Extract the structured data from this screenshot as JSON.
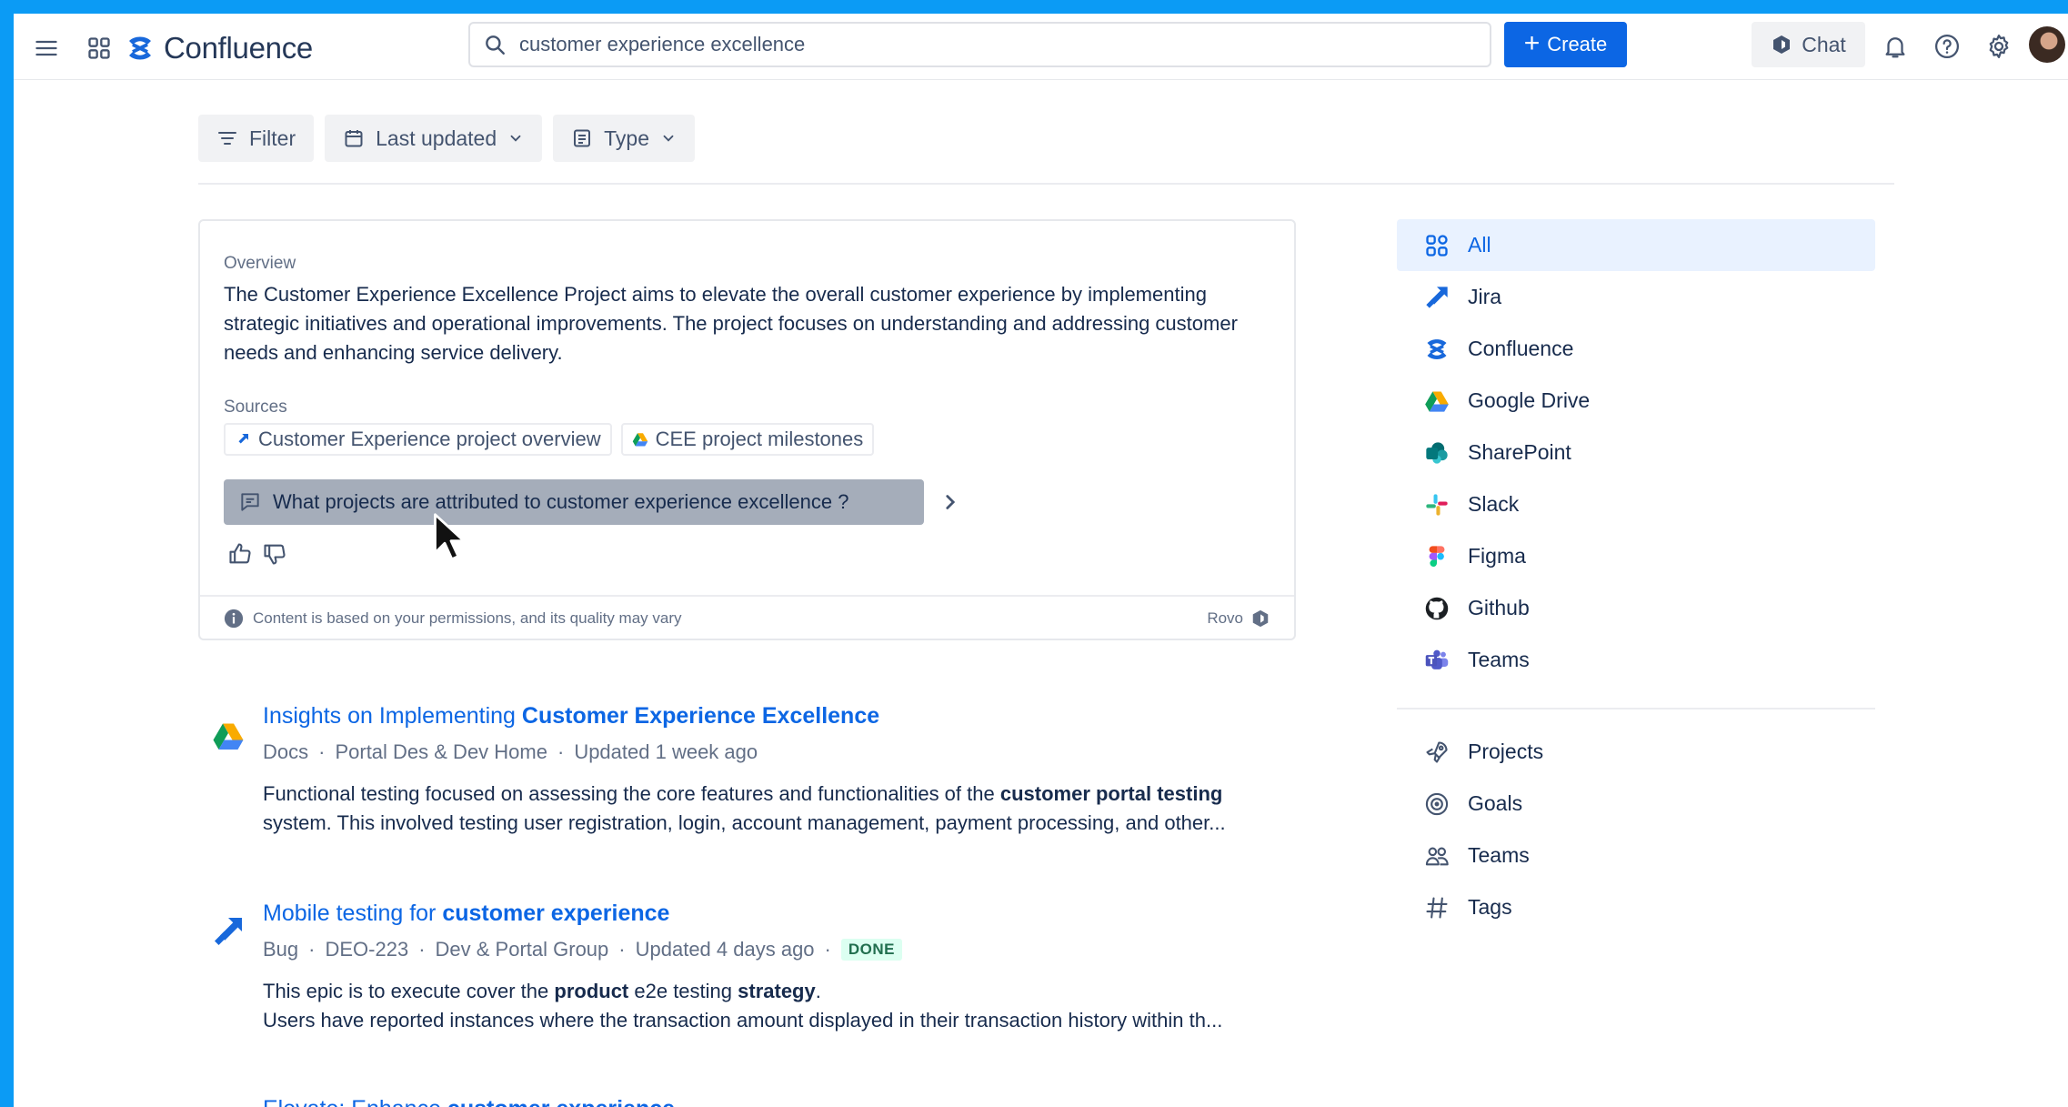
{
  "app": {
    "name": "Confluence"
  },
  "search": {
    "query": "customer experience excellence"
  },
  "header": {
    "create_label": "Create",
    "chat_label": "Chat"
  },
  "filters": {
    "filter_label": "Filter",
    "last_updated_label": "Last updated",
    "type_label": "Type"
  },
  "overview": {
    "label": "Overview",
    "text": "The Customer Experience Excellence Project aims to elevate the overall customer experience by implementing strategic initiatives and operational improvements. The project focuses on understanding and addressing customer needs and enhancing service delivery.",
    "sources_label": "Sources",
    "sources": [
      "Customer Experience project overview",
      "CEE project milestones"
    ],
    "question": "What projects are attributed to customer experience excellence ?",
    "footer_note": "Content is based on your permissions, and its quality may vary",
    "rovo_label": "Rovo"
  },
  "results": [
    {
      "title_prefix": "Insights on Implementing ",
      "title_bold": "Customer Experience Excellence",
      "meta": [
        "Docs",
        "Portal Des & Dev Home",
        "Updated 1 week ago"
      ],
      "desc_1_a": "Functional testing focused on assessing the core features and functionalities of the ",
      "desc_1_b": "customer portal testing",
      "desc_2": "system. This involved testing user registration, login, account management, payment processing, and other..."
    },
    {
      "title_prefix": "Mobile testing for ",
      "title_bold": "customer experience",
      "meta": [
        "Bug",
        "DEO-223",
        "Dev & Portal Group",
        "Updated 4 days ago"
      ],
      "badge": "DONE",
      "desc_1_a": "This epic is to execute cover the ",
      "desc_1_b": "product",
      "desc_1_c": " e2e testing ",
      "desc_1_d": "strategy",
      "desc_1_e": ".",
      "desc_2": "Users have reported instances where the transaction amount displayed in their transaction history within th..."
    },
    {
      "title_prefix": "Elevate: Enhance ",
      "title_bold": "customer experience"
    }
  ],
  "sidebar": {
    "apps": [
      "All",
      "Jira",
      "Confluence",
      "Google Drive",
      "SharePoint",
      "Slack",
      "Figma",
      "Github",
      "Teams"
    ],
    "sections": [
      "Projects",
      "Goals",
      "Teams",
      "Tags"
    ]
  },
  "colors": {
    "accent": "#0c66e4",
    "frame": "#0b9bf5",
    "done_bg": "#dcfff1",
    "done_text": "#216e4e"
  }
}
